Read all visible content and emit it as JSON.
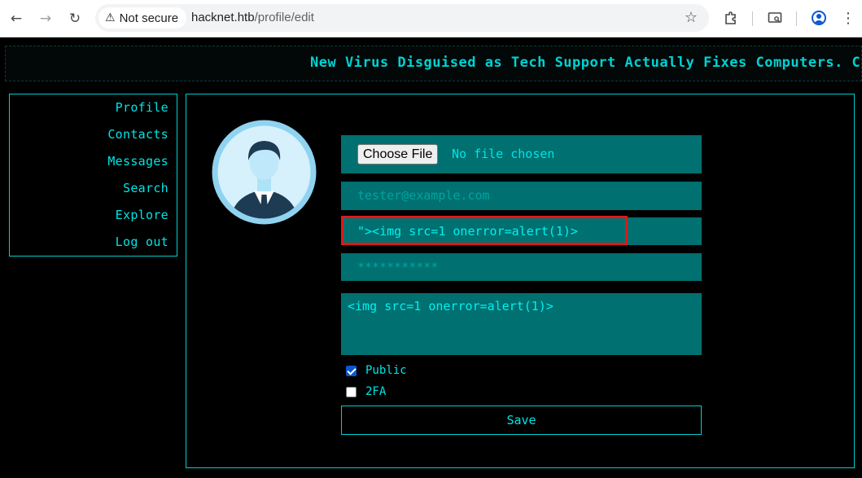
{
  "browser": {
    "security_label": "Not secure",
    "url_host": "hacknet.htb",
    "url_path": "/profile/edit"
  },
  "ticker": {
    "text": "New Virus Disguised as Tech Support Actually Fixes Computers. Con"
  },
  "sidebar": {
    "items": [
      {
        "label": "Profile"
      },
      {
        "label": "Contacts"
      },
      {
        "label": "Messages"
      },
      {
        "label": "Search"
      },
      {
        "label": "Explore"
      },
      {
        "label": "Log out"
      }
    ]
  },
  "form": {
    "file_button_label": "Choose File",
    "file_status": "No file chosen",
    "email_placeholder": "tester@example.com",
    "name_value": "\"><img src=1 onerror=alert(1)>",
    "password_placeholder": "***********",
    "bio_value": "<img src=1 onerror=alert(1)>",
    "public_label": "Public",
    "public_checked": true,
    "twofa_label": "2FA",
    "twofa_checked": false,
    "save_label": "Save"
  },
  "colors": {
    "accent": "#00e5e5",
    "field_bg": "#007070",
    "highlight": "#e01818"
  }
}
